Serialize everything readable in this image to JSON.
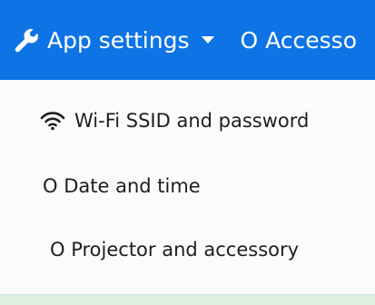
{
  "topbar": {
    "app_settings_label": "App settings",
    "accessory_label": "O Accesso",
    "icons": {
      "wrench": "wrench-icon",
      "dropdown": "caret-down-icon"
    },
    "bg_color": "#0e74e6"
  },
  "menu": {
    "items": [
      {
        "label": "Wi-Fi SSID and password",
        "icon": "wifi-icon"
      },
      {
        "label": "O Date and time"
      },
      {
        "label": "O Projector and accessory"
      }
    ]
  },
  "colors": {
    "text": "#1e1e1e",
    "menu_bg": "#fbfbfb",
    "bottom_strip": "#dcefe0"
  }
}
